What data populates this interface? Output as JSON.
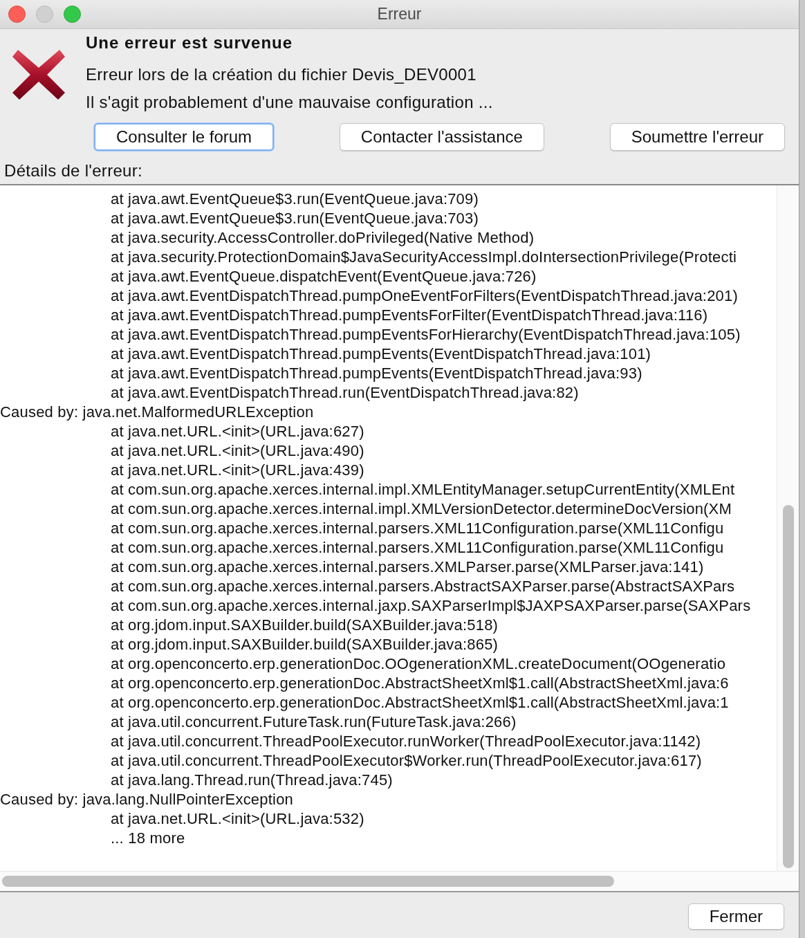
{
  "window": {
    "title": "Erreur"
  },
  "message": {
    "heading": "Une erreur est survenue",
    "lines": [
      "Erreur lors de la création du fichier Devis_DEV0001",
      "Il s'agit probablement d'une mauvaise configuration ..."
    ]
  },
  "actions": [
    {
      "label": "Consulter le forum",
      "focused": true
    },
    {
      "label": "Contacter l'assistance",
      "focused": false
    },
    {
      "label": "Soumettre l'erreur",
      "focused": false
    }
  ],
  "details": {
    "label": "Détails de l'erreur:",
    "lines": [
      {
        "kind": "frame",
        "text": "at java.awt.EventQueue$3.run(EventQueue.java:709)"
      },
      {
        "kind": "frame",
        "text": "at java.awt.EventQueue$3.run(EventQueue.java:703)"
      },
      {
        "kind": "frame",
        "text": "at java.security.AccessController.doPrivileged(Native Method)"
      },
      {
        "kind": "frame",
        "text": "at java.security.ProtectionDomain$JavaSecurityAccessImpl.doIntersectionPrivilege(Protecti"
      },
      {
        "kind": "frame",
        "text": "at java.awt.EventQueue.dispatchEvent(EventQueue.java:726)"
      },
      {
        "kind": "frame",
        "text": "at java.awt.EventDispatchThread.pumpOneEventForFilters(EventDispatchThread.java:201)"
      },
      {
        "kind": "frame",
        "text": "at java.awt.EventDispatchThread.pumpEventsForFilter(EventDispatchThread.java:116)"
      },
      {
        "kind": "frame",
        "text": "at java.awt.EventDispatchThread.pumpEventsForHierarchy(EventDispatchThread.java:105)"
      },
      {
        "kind": "frame",
        "text": "at java.awt.EventDispatchThread.pumpEvents(EventDispatchThread.java:101)"
      },
      {
        "kind": "frame",
        "text": "at java.awt.EventDispatchThread.pumpEvents(EventDispatchThread.java:93)"
      },
      {
        "kind": "frame",
        "text": "at java.awt.EventDispatchThread.run(EventDispatchThread.java:82)"
      },
      {
        "kind": "cause",
        "text": "Caused by: java.net.MalformedURLException"
      },
      {
        "kind": "frame",
        "text": "at java.net.URL.<init>(URL.java:627)"
      },
      {
        "kind": "frame",
        "text": "at java.net.URL.<init>(URL.java:490)"
      },
      {
        "kind": "frame",
        "text": "at java.net.URL.<init>(URL.java:439)"
      },
      {
        "kind": "frame",
        "text": "at com.sun.org.apache.xerces.internal.impl.XMLEntityManager.setupCurrentEntity(XMLEnt"
      },
      {
        "kind": "frame",
        "text": "at com.sun.org.apache.xerces.internal.impl.XMLVersionDetector.determineDocVersion(XM"
      },
      {
        "kind": "frame",
        "text": "at com.sun.org.apache.xerces.internal.parsers.XML11Configuration.parse(XML11Configu"
      },
      {
        "kind": "frame",
        "text": "at com.sun.org.apache.xerces.internal.parsers.XML11Configuration.parse(XML11Configu"
      },
      {
        "kind": "frame",
        "text": "at com.sun.org.apache.xerces.internal.parsers.XMLParser.parse(XMLParser.java:141)"
      },
      {
        "kind": "frame",
        "text": "at com.sun.org.apache.xerces.internal.parsers.AbstractSAXParser.parse(AbstractSAXPars"
      },
      {
        "kind": "frame",
        "text": "at com.sun.org.apache.xerces.internal.jaxp.SAXParserImpl$JAXPSAXParser.parse(SAXPars"
      },
      {
        "kind": "frame",
        "text": "at org.jdom.input.SAXBuilder.build(SAXBuilder.java:518)"
      },
      {
        "kind": "frame",
        "text": "at org.jdom.input.SAXBuilder.build(SAXBuilder.java:865)"
      },
      {
        "kind": "frame",
        "text": "at org.openconcerto.erp.generationDoc.OOgenerationXML.createDocument(OOgeneratio"
      },
      {
        "kind": "frame",
        "text": "at org.openconcerto.erp.generationDoc.AbstractSheetXml$1.call(AbstractSheetXml.java:6"
      },
      {
        "kind": "frame",
        "text": "at org.openconcerto.erp.generationDoc.AbstractSheetXml$1.call(AbstractSheetXml.java:1"
      },
      {
        "kind": "frame",
        "text": "at java.util.concurrent.FutureTask.run(FutureTask.java:266)"
      },
      {
        "kind": "frame",
        "text": "at java.util.concurrent.ThreadPoolExecutor.runWorker(ThreadPoolExecutor.java:1142)"
      },
      {
        "kind": "frame",
        "text": "at java.util.concurrent.ThreadPoolExecutor$Worker.run(ThreadPoolExecutor.java:617)"
      },
      {
        "kind": "frame",
        "text": "at java.lang.Thread.run(Thread.java:745)"
      },
      {
        "kind": "cause",
        "text": "Caused by: java.lang.NullPointerException"
      },
      {
        "kind": "frame",
        "text": "at java.net.URL.<init>(URL.java:532)"
      },
      {
        "kind": "frame",
        "text": "... 18 more"
      }
    ]
  },
  "footer": {
    "close_button": "Fermer"
  }
}
